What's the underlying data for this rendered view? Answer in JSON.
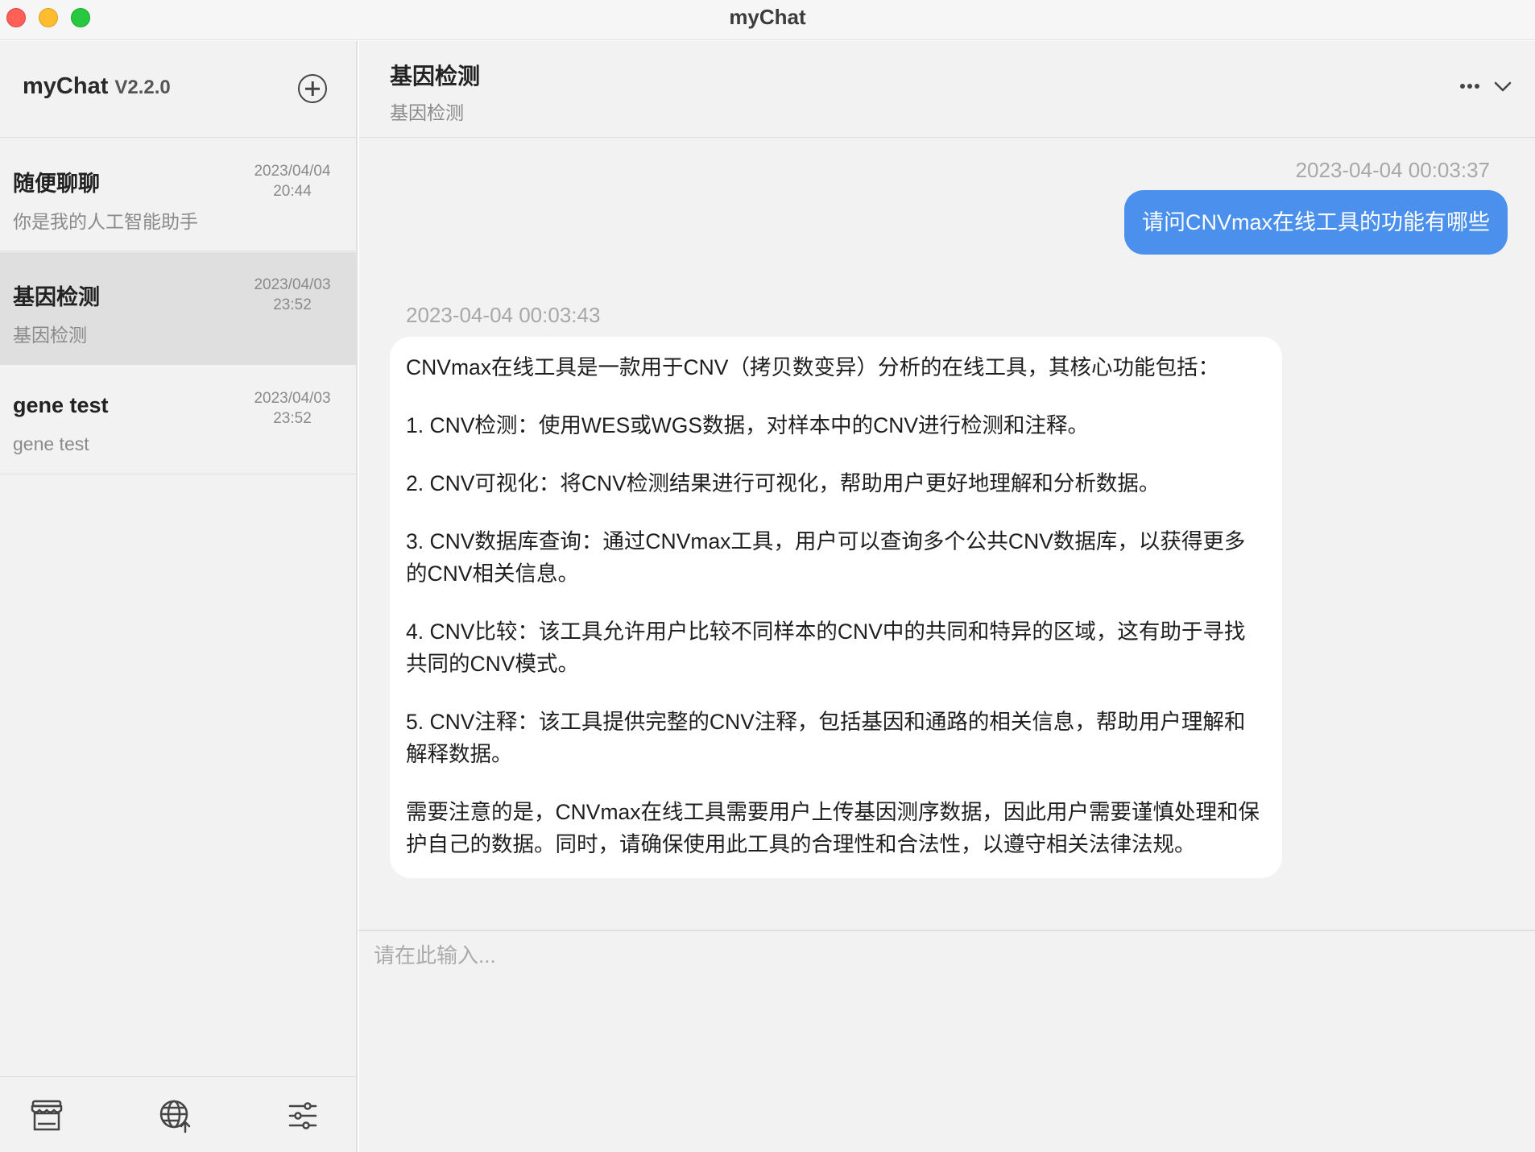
{
  "window": {
    "title": "myChat",
    "controls": [
      "close",
      "minimize",
      "zoom"
    ]
  },
  "sidebar": {
    "app_name": "myChat",
    "version": "V2.2.0",
    "new_chat_icon": "plus-circle-icon",
    "conversations": [
      {
        "title": "随便聊聊",
        "subtitle": "你是我的人工智能助手",
        "date": "2023/04/04",
        "time": "20:44",
        "active": false
      },
      {
        "title": "基因检测",
        "subtitle": "基因检测",
        "date": "2023/04/03",
        "time": "23:52",
        "active": true
      },
      {
        "title": "gene test",
        "subtitle": "gene test",
        "date": "2023/04/03",
        "time": "23:52",
        "active": false
      }
    ],
    "footer_icons": [
      "store-icon",
      "globe-upload-icon",
      "settings-sliders-icon"
    ]
  },
  "chat": {
    "title": "基因检测",
    "subtitle": "基因检测",
    "header_icons": [
      "more-icon",
      "chevron-down-icon"
    ],
    "messages": [
      {
        "role": "user",
        "timestamp": "2023-04-04 00:03:37",
        "text": "请问CNVmax在线工具的功能有哪些"
      },
      {
        "role": "assistant",
        "timestamp": "2023-04-04 00:03:43",
        "paragraphs": [
          "CNVmax在线工具是一款用于CNV（拷贝数变异）分析的在线工具，其核心功能包括：",
          "1. CNV检测：使用WES或WGS数据，对样本中的CNV进行检测和注释。",
          "2. CNV可视化：将CNV检测结果进行可视化，帮助用户更好地理解和分析数据。",
          "3. CNV数据库查询：通过CNVmax工具，用户可以查询多个公共CNV数据库，以获得更多的CNV相关信息。",
          "4. CNV比较：该工具允许用户比较不同样本的CNV中的共同和特异的区域，这有助于寻找共同的CNV模式。",
          "5. CNV注释：该工具提供完整的CNV注释，包括基因和通路的相关信息，帮助用户理解和解释数据。",
          "需要注意的是，CNVmax在线工具需要用户上传基因测序数据，因此用户需要谨慎处理和保护自己的数据。同时，请确保使用此工具的合理性和合法性，以遵守相关法律法规。"
        ]
      }
    ],
    "input_placeholder": "请在此输入..."
  },
  "colors": {
    "user_bubble": "#4a90ec",
    "sidebar_bg": "#f2f2f2",
    "active_conversation": "#dfdfdf",
    "assistant_bubble": "#ffffff"
  }
}
